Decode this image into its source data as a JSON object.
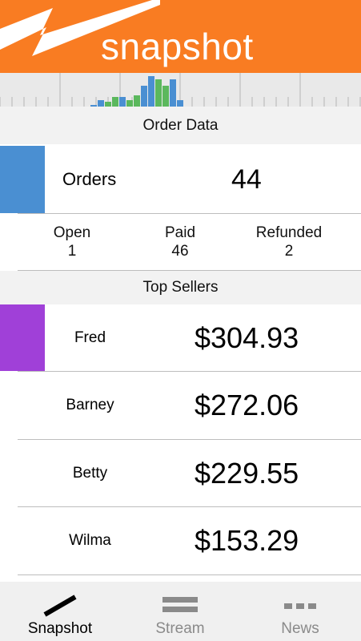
{
  "app": {
    "brand": "snapshot",
    "accent_color": "#f97c22"
  },
  "spark_chart": {
    "bars": [
      {
        "value": 0.05,
        "color": "#4a8fd2"
      },
      {
        "value": 0.2,
        "color": "#4a8fd2"
      },
      {
        "value": 0.15,
        "color": "#5bb85d"
      },
      {
        "value": 0.3,
        "color": "#5bb85d"
      },
      {
        "value": 0.3,
        "color": "#4a8fd2"
      },
      {
        "value": 0.2,
        "color": "#5bb85d"
      },
      {
        "value": 0.35,
        "color": "#5bb85d"
      },
      {
        "value": 0.65,
        "color": "#4a8fd2"
      },
      {
        "value": 0.95,
        "color": "#4a8fd2"
      },
      {
        "value": 0.85,
        "color": "#5bb85d"
      },
      {
        "value": 0.65,
        "color": "#5bb85d"
      },
      {
        "value": 0.85,
        "color": "#4a8fd2"
      },
      {
        "value": 0.2,
        "color": "#4a8fd2"
      }
    ]
  },
  "order_data": {
    "title": "Order Data",
    "orders_label": "Orders",
    "orders_value": "44",
    "orders_color": "#4a8fd2",
    "open_label": "Open",
    "open_value": "1",
    "paid_label": "Paid",
    "paid_value": "46",
    "refunded_label": "Refunded",
    "refunded_value": "2"
  },
  "top_sellers": {
    "title": "Top Sellers",
    "highlight_color": "#a040d8",
    "sellers": [
      {
        "name": "Fred",
        "amount": "$304.93"
      },
      {
        "name": "Barney",
        "amount": "$272.06"
      },
      {
        "name": "Betty",
        "amount": "$229.55"
      },
      {
        "name": "Wilma",
        "amount": "$153.29"
      }
    ]
  },
  "tabs": [
    {
      "label": "Snapshot",
      "icon": "slash-icon",
      "active": true
    },
    {
      "label": "Stream",
      "icon": "stream-bars-icon",
      "active": false
    },
    {
      "label": "News",
      "icon": "dots-icon",
      "active": false
    }
  ]
}
